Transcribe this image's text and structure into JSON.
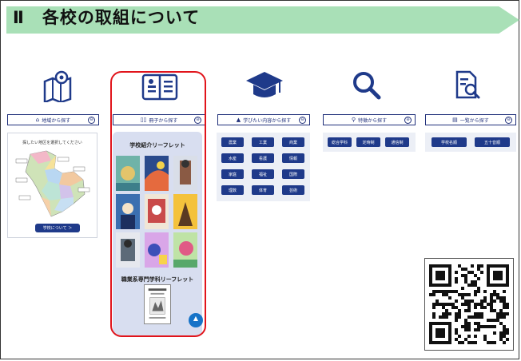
{
  "banner": {
    "number": "Ⅱ",
    "title": "各校の取組について"
  },
  "categories": [
    {
      "label": "地域から探す",
      "icon": "map-icon"
    },
    {
      "label": "冊子から探す",
      "icon": "book-icon"
    },
    {
      "label": "学びたい内容から探す",
      "icon": "graduation-cap-icon"
    },
    {
      "label": "特徴から探す",
      "icon": "magnifier-icon"
    },
    {
      "label": "一覧から探す",
      "icon": "document-search-icon"
    }
  ],
  "toggle_glyph": "⊖",
  "map_panel": {
    "caption": "探したい地区を選択してください",
    "button": "学校について ＞"
  },
  "book_panel": {
    "title": "学校紹介リーフレット",
    "subtitle": "職業系専門学科リーフレット",
    "scroll_top": "▲"
  },
  "subject_pills": [
    "農業",
    "工業",
    "商業",
    "水産",
    "看護",
    "情報",
    "家庭",
    "福祉",
    "国際",
    "理数",
    "体育",
    "芸術"
  ],
  "feature_pills": [
    "総合学科",
    "定時制",
    "通信制"
  ],
  "list_pills": [
    "学校名順",
    "五十音順"
  ],
  "colors": {
    "banner": "#a9e0b7",
    "accent": "#1f3a8a",
    "highlight": "#e1141b"
  }
}
